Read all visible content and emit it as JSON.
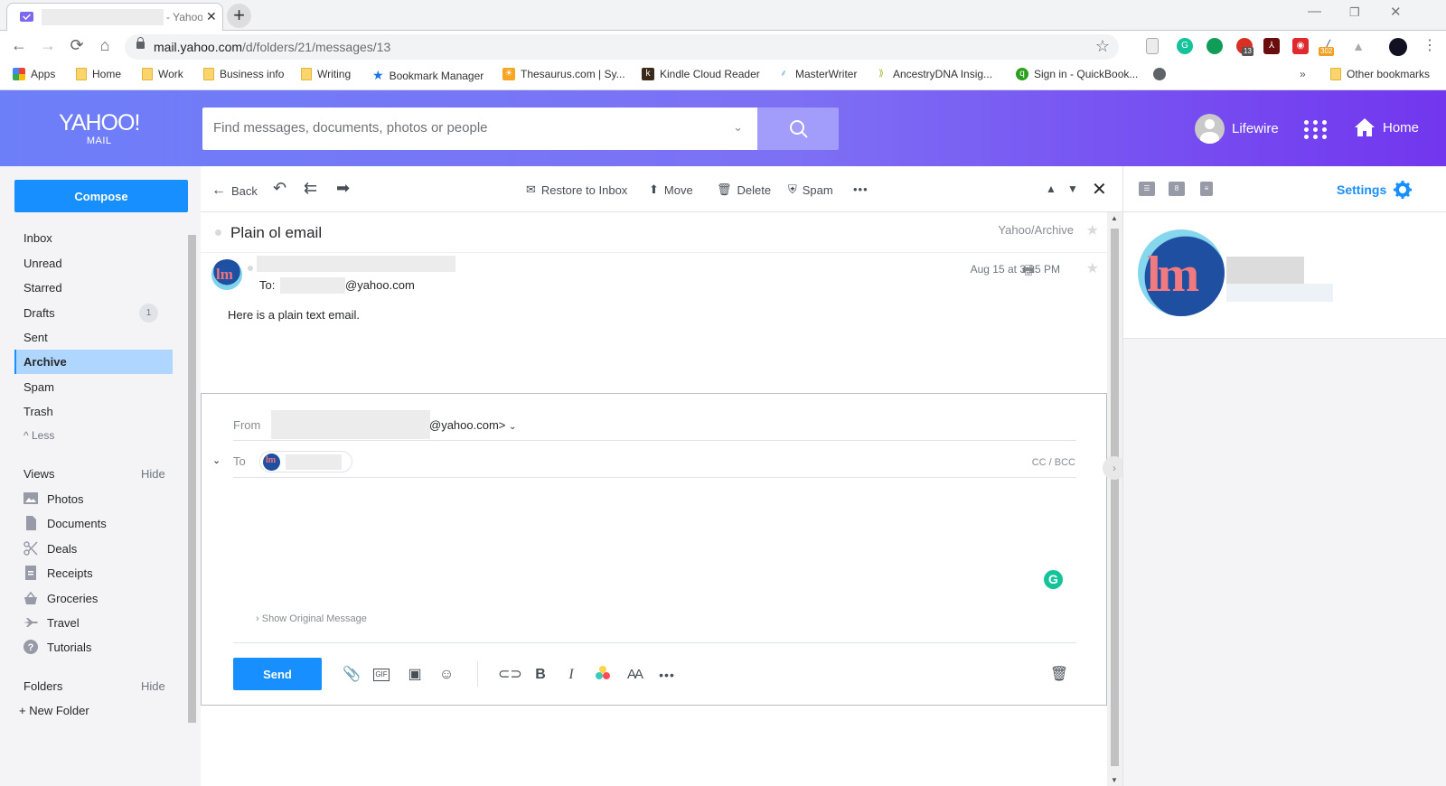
{
  "browser": {
    "tab_title": "- Yahoo",
    "url_host": "mail.yahoo.com",
    "url_path": "/d/folders/21/messages/13",
    "window_controls": {
      "minimize": "—",
      "restore": "❐",
      "close": "✕"
    },
    "extensions": [
      {
        "name": "document-icon"
      },
      {
        "name": "grammarly-icon",
        "glyph": "G",
        "color": "#15c39a"
      },
      {
        "name": "hangouts-icon",
        "color": "#0f9d58"
      },
      {
        "name": "extension-icon",
        "badge": "13",
        "color": "#d93025"
      },
      {
        "name": "adobe-acrobat-icon",
        "color": "#8b0000"
      },
      {
        "name": "pocket-icon",
        "color": "#e0282f"
      },
      {
        "name": "counter-extension-icon",
        "badge": "302"
      },
      {
        "name": "google-drive-icon"
      }
    ],
    "bookmarks": [
      {
        "label": "Apps",
        "icon": "apps-grid-icon"
      },
      {
        "label": "Home",
        "icon": "folder-icon"
      },
      {
        "label": "Work",
        "icon": "folder-icon"
      },
      {
        "label": "Business info",
        "icon": "folder-icon"
      },
      {
        "label": "Writing",
        "icon": "folder-icon"
      },
      {
        "label": "Bookmark Manager",
        "icon": "star-icon"
      },
      {
        "label": "Thesaurus.com | Sy...",
        "icon": "thesaurus-icon"
      },
      {
        "label": "Kindle Cloud Reader",
        "icon": "kindle-icon"
      },
      {
        "label": "MasterWriter",
        "icon": "masterwriter-icon"
      },
      {
        "label": "AncestryDNA Insig...",
        "icon": "ancestry-icon"
      },
      {
        "label": "Sign in - QuickBook...",
        "icon": "quickbooks-icon"
      }
    ],
    "bookmarks_overflow": "»",
    "other_bookmarks": "Other bookmarks"
  },
  "header": {
    "logo_top": "YAHOO!",
    "logo_bottom": "MAIL",
    "search_placeholder": "Find messages, documents, photos or people",
    "user_name": "Lifewire",
    "home_label": "Home"
  },
  "nav": {
    "compose": "Compose",
    "folders": [
      {
        "label": "Inbox"
      },
      {
        "label": "Unread"
      },
      {
        "label": "Starred"
      },
      {
        "label": "Drafts",
        "count": "1"
      },
      {
        "label": "Sent"
      },
      {
        "label": "Archive",
        "active": true
      },
      {
        "label": "Spam"
      },
      {
        "label": "Trash"
      }
    ],
    "less": "Less",
    "views_header": "Views",
    "views_hide": "Hide",
    "views": [
      {
        "label": "Photos",
        "icon": "photos-icon"
      },
      {
        "label": "Documents",
        "icon": "documents-icon"
      },
      {
        "label": "Deals",
        "icon": "scissors-icon"
      },
      {
        "label": "Receipts",
        "icon": "receipt-icon"
      },
      {
        "label": "Groceries",
        "icon": "basket-icon"
      },
      {
        "label": "Travel",
        "icon": "airplane-icon"
      },
      {
        "label": "Tutorials",
        "icon": "help-icon"
      }
    ],
    "folders_header": "Folders",
    "folders_hide": "Hide",
    "new_folder": "New Folder"
  },
  "toolbar": {
    "back": "Back",
    "restore": "Restore to Inbox",
    "move": "Move",
    "delete": "Delete",
    "spam": "Spam",
    "more": "•••"
  },
  "message": {
    "subject": "Plain ol email",
    "folder": "Yahoo/Archive",
    "to_label": "To:",
    "to_address_suffix": "@yahoo.com",
    "date": "Aug 15 at 3:25 PM",
    "body": "Here is a plain text email."
  },
  "reply": {
    "from_label": "From",
    "from_suffix": "@yahoo.com>",
    "to_label": "To",
    "cc_bcc": "CC / BCC",
    "show_original": "Show Original Message",
    "send": "Send",
    "grammarly": "G"
  },
  "right_pane": {
    "settings": "Settings",
    "contact_avatar_text": "lm"
  }
}
